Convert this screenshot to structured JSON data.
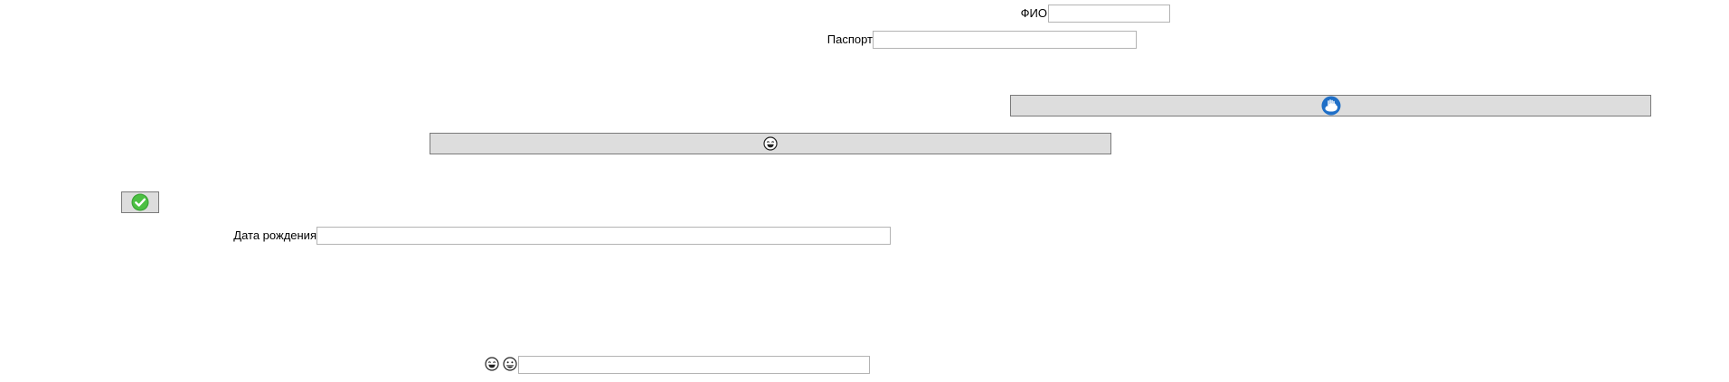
{
  "form": {
    "fio_label": "ФИО",
    "fio_value": "",
    "passport_label": "Паспорт",
    "passport_value": "",
    "birth_label": "Дата рождения",
    "birth_value": "",
    "bottom_value": ""
  },
  "buttons": {
    "cloud_button_icon": "cloud-hand-icon",
    "smiley_button_icon": "laughing-face-icon",
    "confirm_button_icon": "check-circle-icon"
  },
  "bottom_icons": [
    "laughing-face-icon",
    "grinning-face-icon"
  ],
  "colors": {
    "button_bg": "#dddddd",
    "button_border": "#7a7a7a",
    "field_border": "#b3b3b3",
    "accent_blue": "#1f6fc7",
    "check_green": "#3aa635"
  }
}
